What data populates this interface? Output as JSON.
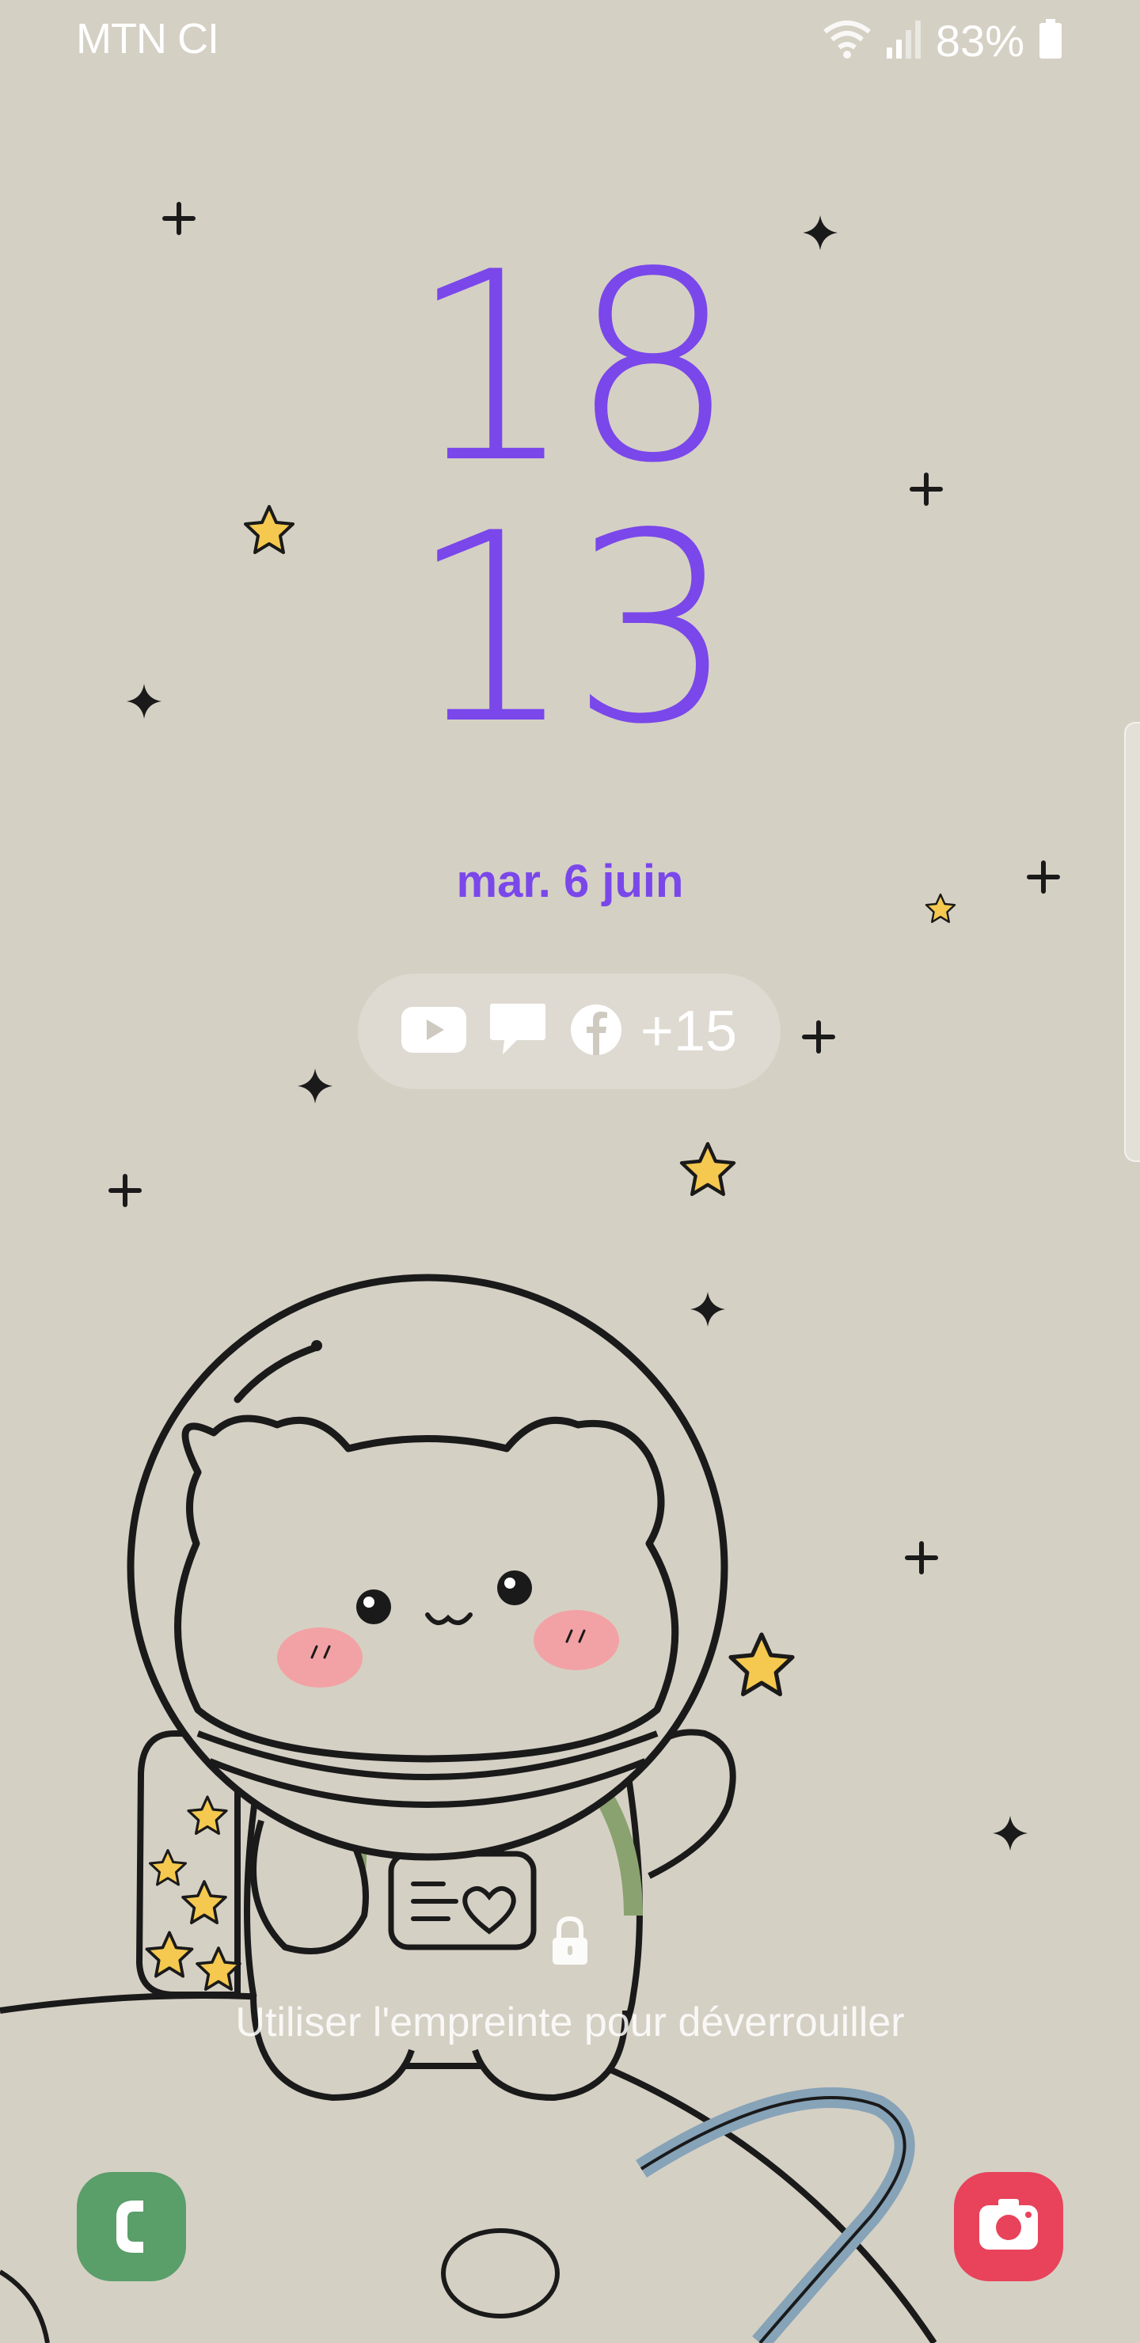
{
  "status_bar": {
    "carrier": "MTN CI",
    "battery_percent": "83%",
    "icons": [
      "wifi-icon",
      "signal-icon",
      "battery-icon"
    ]
  },
  "clock": {
    "hours": "18",
    "minutes": "13"
  },
  "date": "mar. 6 juin",
  "notifications": {
    "icons": [
      "youtube-icon",
      "message-icon",
      "facebook-icon"
    ],
    "more_count": "+15"
  },
  "unlock_hint": "Utiliser l'empreinte pour déverrouiller",
  "shortcuts": {
    "left": "phone-icon",
    "right": "camera-icon"
  },
  "colors": {
    "accent": "#7a47ea",
    "background": "#d5d0c4",
    "phone": "#5a9e6a",
    "camera": "#e8435b"
  }
}
